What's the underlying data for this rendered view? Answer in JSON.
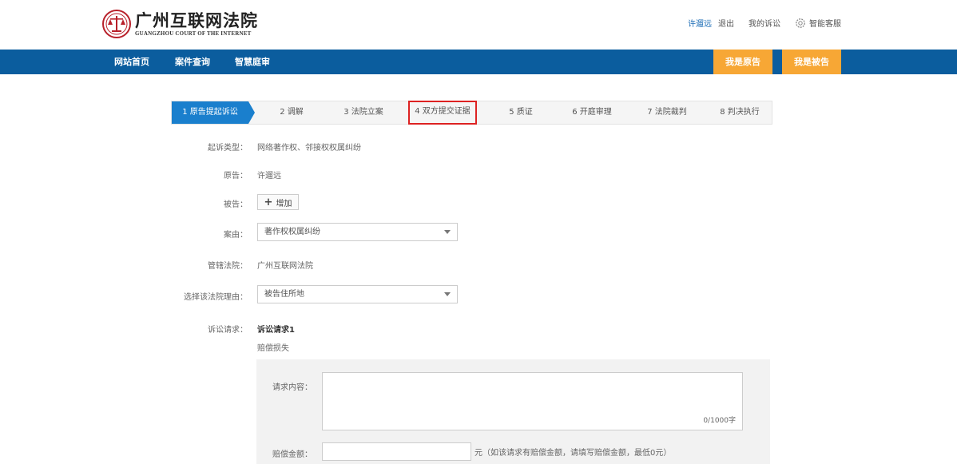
{
  "logo": {
    "cn": "广州互联网法院",
    "en": "GUANGZHOU COURT OF THE INTERNET"
  },
  "top_links": {
    "user": "许遛远",
    "logout": "退出",
    "my_case": "我的诉讼",
    "service": "智能客服"
  },
  "nav": {
    "items": [
      "网站首页",
      "案件查询",
      "智慧庭审"
    ],
    "plaintiff_btn": "我是原告",
    "defendant_btn": "我是被告"
  },
  "steps": [
    "1 原告提起诉讼",
    "2 调解",
    "3 法院立案",
    "4 双方提交证据",
    "5 质证",
    "6 开庭审理",
    "7 法院裁判",
    "8 判决执行"
  ],
  "form": {
    "case_type_label": "起诉类型：",
    "case_type_value": "网络著作权、邻接权权属纠纷",
    "plaintiff_label": "原告：",
    "plaintiff_value": "许遛远",
    "defendant_label": "被告：",
    "add_label": "增加",
    "cause_label": "案由：",
    "cause_value": "著作权权属纠纷",
    "court_label": "管辖法院：",
    "court_value": "广州互联网法院",
    "reason_label": "选择该法院理由：",
    "reason_value": "被告住所地",
    "claim_label": "诉讼请求：",
    "claim_title": "诉讼请求1",
    "claim_sub": "赔偿损失",
    "content_label": "请求内容：",
    "content_counter": "0/1000字",
    "amount_label": "赔偿金额：",
    "amount_hint": "元（如该请求有赔偿金额，请填写赔偿金额，最低0元）"
  },
  "colors": {
    "nav_bg": "#0b5d9e",
    "accent_orange": "#f7a735",
    "step_active": "#1a7fcd",
    "highlight": "#dd2222"
  }
}
